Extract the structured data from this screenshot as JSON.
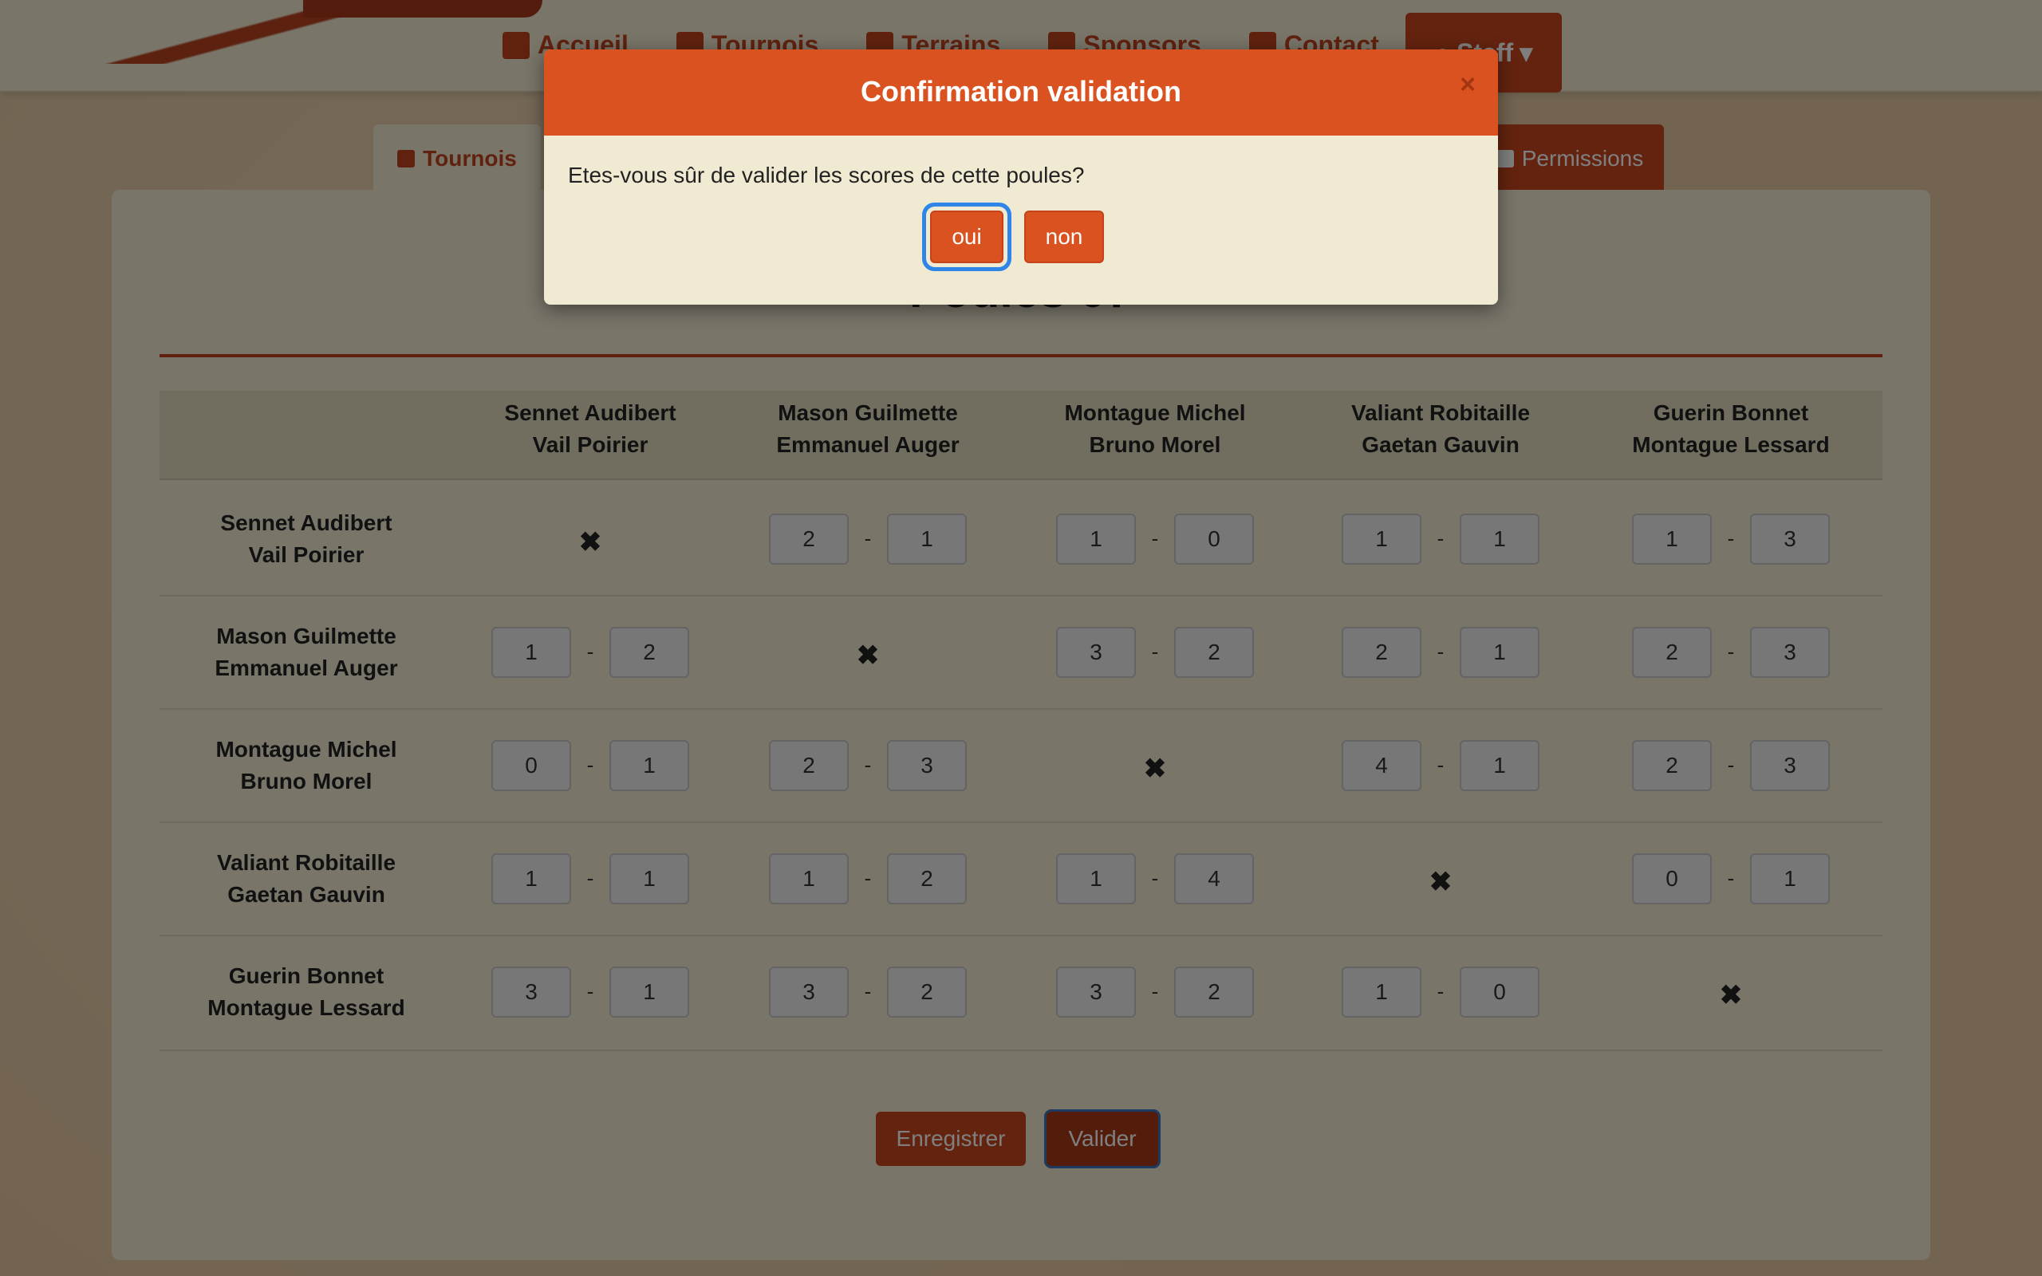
{
  "nav": {
    "items": [
      "Accueil",
      "Tournois",
      "Terrains",
      "Sponsors",
      "Contact"
    ],
    "staff": "Staff"
  },
  "tabs": {
    "active": "Tournois",
    "permissions": "Permissions"
  },
  "page": {
    "title": "Poules 07"
  },
  "grid": {
    "teams": [
      [
        "Sennet Audibert",
        "Vail Poirier"
      ],
      [
        "Mason Guilmette",
        "Emmanuel Auger"
      ],
      [
        "Montague Michel",
        "Bruno Morel"
      ],
      [
        "Valiant Robitaille",
        "Gaetan Gauvin"
      ],
      [
        "Guerin Bonnet",
        "Montague Lessard"
      ]
    ],
    "scores": [
      [
        null,
        [
          "2",
          "1"
        ],
        [
          "1",
          "0"
        ],
        [
          "1",
          "1"
        ],
        [
          "1",
          "3"
        ]
      ],
      [
        [
          "1",
          "2"
        ],
        null,
        [
          "3",
          "2"
        ],
        [
          "2",
          "1"
        ],
        [
          "2",
          "3"
        ]
      ],
      [
        [
          "0",
          "1"
        ],
        [
          "2",
          "3"
        ],
        null,
        [
          "4",
          "1"
        ],
        [
          "2",
          "3"
        ]
      ],
      [
        [
          "1",
          "1"
        ],
        [
          "1",
          "2"
        ],
        [
          "1",
          "4"
        ],
        null,
        [
          "0",
          "1"
        ]
      ],
      [
        [
          "3",
          "1"
        ],
        [
          "3",
          "2"
        ],
        [
          "3",
          "2"
        ],
        [
          "1",
          "0"
        ],
        null
      ]
    ],
    "separator": "-",
    "self_mark": "✖"
  },
  "actions": {
    "save": "Enregistrer",
    "validate": "Valider"
  },
  "modal": {
    "title": "Confirmation validation",
    "close": "×",
    "message": "Etes-vous sûr de valider les scores de cette poules?",
    "yes": "oui",
    "no": "non"
  },
  "colors": {
    "accent": "#d9521f",
    "focus_ring": "#2f86e8",
    "panel": "#f3ead2"
  }
}
